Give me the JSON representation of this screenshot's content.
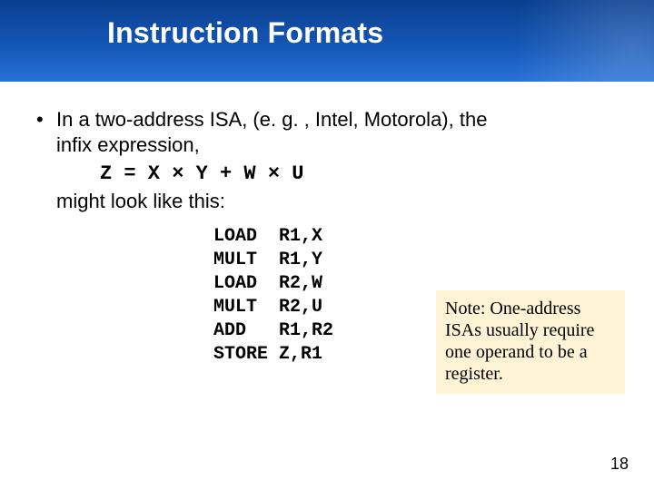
{
  "title": "Instruction Formats",
  "bullet_line1": "In a two-address ISA, (e. g. , Intel, Motorola), the",
  "bullet_line2": "infix expression,",
  "expression": "Z = X × Y + W × U",
  "might_line": "might look like this:",
  "code": {
    "l1": "LOAD  R1,X",
    "l2": "MULT  R1,Y",
    "l3": "LOAD  R2,W",
    "l4": "MULT  R2,U",
    "l5": "ADD   R1,R2",
    "l6": "STORE Z,R1"
  },
  "note": "Note: One-address ISAs usually require one operand to be a register.",
  "page_number": "18"
}
